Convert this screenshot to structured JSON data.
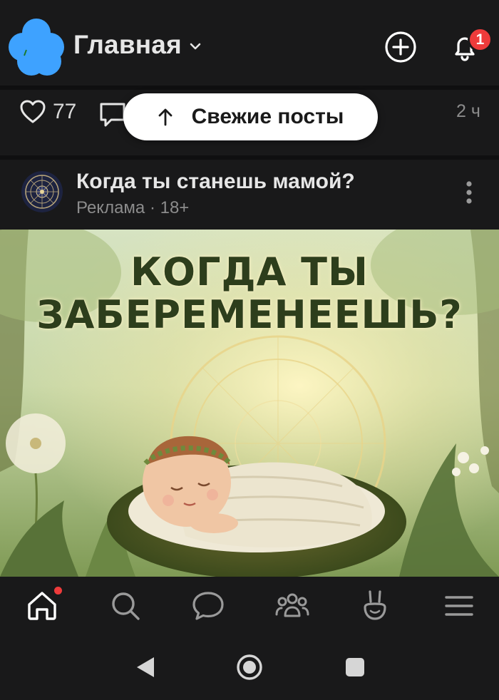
{
  "header": {
    "title": "Главная",
    "notifications_count": "1"
  },
  "previous_post": {
    "likes": "77",
    "time": "2 ч"
  },
  "fresh_posts_button": {
    "label": "Свежие посты"
  },
  "ad_post": {
    "title": "Когда ты станешь мамой?",
    "meta": "Реклама · 18+",
    "banner_headline_line1": "КОГДА ТЫ",
    "banner_headline_line2": "ЗАБЕРЕМЕНЕЕШЬ?"
  },
  "tabbar": {
    "items": [
      "home-icon",
      "search-icon",
      "messages-icon",
      "communities-icon",
      "services-icon",
      "menu-icon"
    ],
    "home_has_update": true
  },
  "colors": {
    "background": "#19191a",
    "accent_blue": "#3ea2ff",
    "badge_red": "#ee3b3b"
  }
}
